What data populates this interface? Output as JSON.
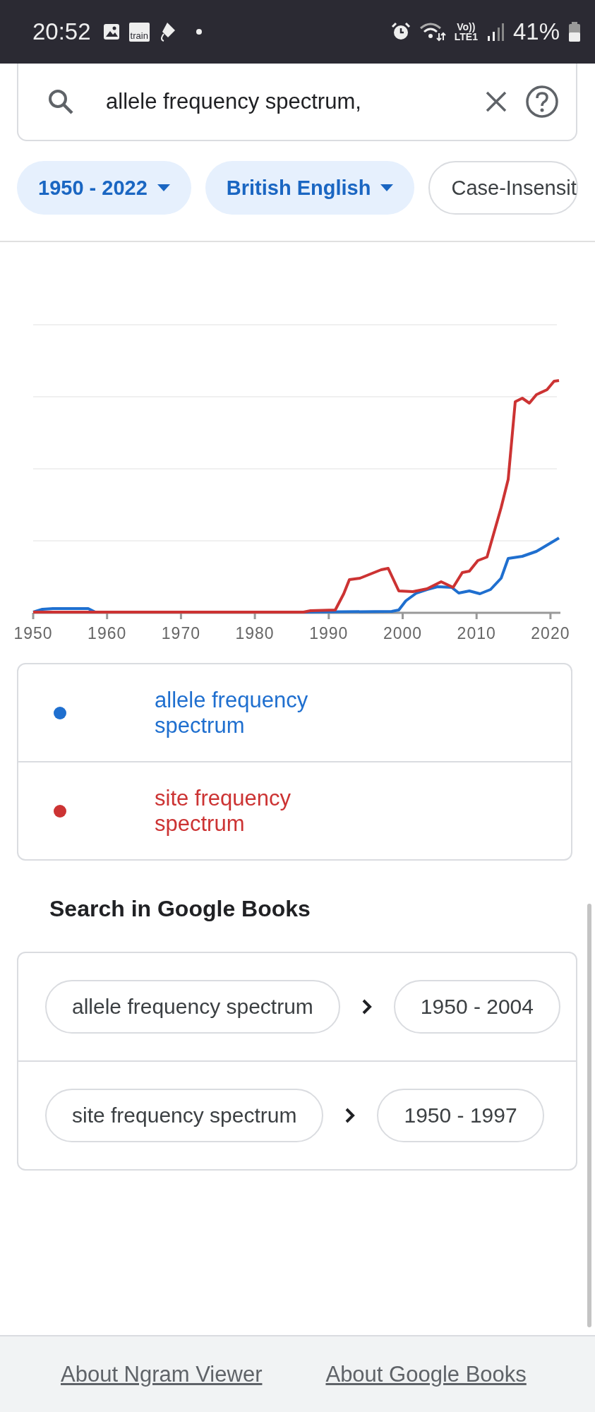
{
  "status_bar": {
    "time": "20:52",
    "app_badge": "train",
    "network_top": "Vo))",
    "network_bottom": "LTE1",
    "battery": "41%"
  },
  "search": {
    "value": "allele frequency spectrum,"
  },
  "filters": [
    {
      "label": "1950 - 2022",
      "kind": "dropdown"
    },
    {
      "label": "British English",
      "kind": "dropdown"
    },
    {
      "label": "Case-Insensit",
      "kind": "option"
    }
  ],
  "chart": {
    "x_labels": [
      "1950",
      "1960",
      "1970",
      "1980",
      "1990",
      "2000",
      "2010",
      "2020"
    ]
  },
  "legend": [
    {
      "label": "allele frequency spectrum",
      "color": "#1f6fcf"
    },
    {
      "label": "site frequency spectrum",
      "color": "#cc3333"
    }
  ],
  "books_heading": "Search in Google Books",
  "books": [
    {
      "query": "allele frequency spectrum",
      "range": "1950 - 2004"
    },
    {
      "query": "site frequency spectrum",
      "range": "1950 - 1997"
    }
  ],
  "footer_links": [
    "About Ngram Viewer",
    "About Google Books"
  ]
}
